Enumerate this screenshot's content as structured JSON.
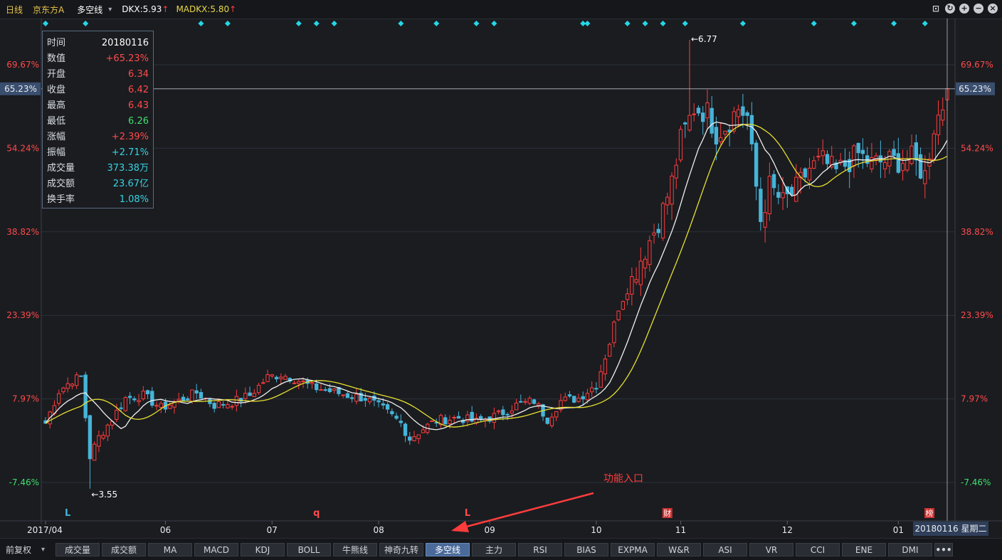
{
  "topbar": {
    "period": "日线",
    "stock": "京东方A",
    "indicator": "多空线",
    "dropdown": "▾",
    "dkx": "DKX:5.93",
    "madkx": "MADKX:5.80",
    "up_arrow": "↑"
  },
  "infobox": {
    "rows": [
      {
        "label": "时间",
        "value": "20180116",
        "color": "white"
      },
      {
        "label": "数值",
        "value": "+65.23%",
        "color": "red"
      },
      {
        "label": "开盘",
        "value": "6.34",
        "color": "red"
      },
      {
        "label": "收盘",
        "value": "6.42",
        "color": "red"
      },
      {
        "label": "最高",
        "value": "6.43",
        "color": "red"
      },
      {
        "label": "最低",
        "value": "6.26",
        "color": "green"
      },
      {
        "label": "涨幅",
        "value": "+2.39%",
        "color": "red"
      },
      {
        "label": "振幅",
        "value": "+2.71%",
        "color": "cyan"
      },
      {
        "label": "成交量",
        "value": "373.38万",
        "color": "cyan"
      },
      {
        "label": "成交额",
        "value": "23.67亿",
        "color": "cyan"
      },
      {
        "label": "换手率",
        "value": "1.08%",
        "color": "cyan"
      }
    ]
  },
  "annotation": "功能入口",
  "date_badge": "20180116 星期二",
  "bottombar": {
    "adjust": "前复权",
    "dropdown": "▾",
    "tabs": [
      "成交量",
      "成交额",
      "MA",
      "MACD",
      "KDJ",
      "BOLL",
      "牛熊线",
      "神奇九转",
      "多空线",
      "主力",
      "RSI",
      "BIAS",
      "EXPMA",
      "W&R",
      "ASI",
      "VR",
      "CCI",
      "ENE",
      "DMI"
    ],
    "active_tab": "多空线",
    "more": "•••"
  },
  "colors": {
    "up": "#ff3c3c",
    "down": "#46b4d8",
    "dkx_line": "#f0f0f0",
    "madkx_line": "#e8e030",
    "signal": "#26d6e6",
    "background": "#1a1c20"
  },
  "chart_data": {
    "type": "candlestick",
    "y_axis_labels": [
      "69.67%",
      "54.24%",
      "38.82%",
      "23.39%",
      "7.97%",
      "-7.46%"
    ],
    "y_axis_values": [
      69.67,
      54.24,
      38.82,
      23.39,
      7.97,
      -7.46
    ],
    "crosshair_value": "65.23%",
    "crosshair_pct": 65.23,
    "x_axis_labels": [
      "2017/04",
      "06",
      "07",
      "08",
      "09",
      "10",
      "11",
      "12",
      "01"
    ],
    "x_axis_label_bars": [
      0,
      27,
      51,
      75,
      100,
      124,
      143,
      167,
      192
    ],
    "bar_count": 204,
    "price_base": 3.8848,
    "markers": [
      {
        "text": "←6.77",
        "bar": 145,
        "price": 6.77,
        "type": "high"
      },
      {
        "text": "←3.55",
        "bar": 10,
        "price": 3.55,
        "type": "low"
      }
    ],
    "bottom_flags": [
      {
        "text": "L",
        "bar": 5,
        "style": "cyan-text"
      },
      {
        "text": "q",
        "bar": 61,
        "style": "red-text"
      },
      {
        "text": "L",
        "bar": 95,
        "style": "red-text"
      },
      {
        "text": "财",
        "bar": 140,
        "style": "red-box"
      },
      {
        "text": "榜",
        "bar": 199,
        "style": "red-box"
      }
    ],
    "signal_bars": [
      0,
      9,
      35,
      41,
      57,
      61,
      65,
      80,
      88,
      97,
      101,
      121,
      122,
      131,
      135,
      139,
      144,
      157,
      173,
      182,
      191,
      198
    ],
    "anchors": [
      [
        0,
        4.02
      ],
      [
        3,
        4.25
      ],
      [
        6,
        4.33
      ],
      [
        8,
        4.35
      ],
      [
        10,
        3.78
      ],
      [
        12,
        3.92
      ],
      [
        15,
        4.05
      ],
      [
        18,
        4.2
      ],
      [
        22,
        4.22
      ],
      [
        26,
        4.13
      ],
      [
        30,
        4.18
      ],
      [
        34,
        4.24
      ],
      [
        38,
        4.15
      ],
      [
        42,
        4.17
      ],
      [
        46,
        4.22
      ],
      [
        50,
        4.35
      ],
      [
        53,
        4.37
      ],
      [
        56,
        4.34
      ],
      [
        60,
        4.28
      ],
      [
        64,
        4.25
      ],
      [
        68,
        4.22
      ],
      [
        72,
        4.2
      ],
      [
        76,
        4.12
      ],
      [
        80,
        4.02
      ],
      [
        82,
        3.91
      ],
      [
        85,
        3.98
      ],
      [
        88,
        4.04
      ],
      [
        93,
        4.06
      ],
      [
        97,
        4.03
      ],
      [
        102,
        4.08
      ],
      [
        106,
        4.15
      ],
      [
        110,
        4.18
      ],
      [
        113,
        4.05
      ],
      [
        116,
        4.18
      ],
      [
        120,
        4.2
      ],
      [
        124,
        4.3
      ],
      [
        127,
        4.6
      ],
      [
        129,
        4.85
      ],
      [
        132,
        5.05
      ],
      [
        134,
        5.2
      ],
      [
        137,
        5.4
      ],
      [
        139,
        5.55
      ],
      [
        141,
        5.75
      ],
      [
        143,
        6.05
      ],
      [
        146,
        6.28
      ],
      [
        149,
        6.25
      ],
      [
        151,
        6.1
      ],
      [
        153,
        6.15
      ],
      [
        156,
        6.28
      ],
      [
        158,
        6.22
      ],
      [
        159,
        5.95
      ],
      [
        161,
        5.48
      ],
      [
        163,
        5.72
      ],
      [
        166,
        5.6
      ],
      [
        169,
        5.7
      ],
      [
        172,
        5.85
      ],
      [
        175,
        5.9
      ],
      [
        178,
        5.82
      ],
      [
        181,
        5.9
      ],
      [
        183,
        5.95
      ],
      [
        186,
        5.88
      ],
      [
        189,
        5.9
      ],
      [
        192,
        5.9
      ],
      [
        195,
        5.92
      ],
      [
        198,
        5.8
      ],
      [
        200,
        6.15
      ],
      [
        202,
        6.3
      ],
      [
        203,
        6.42
      ]
    ]
  }
}
